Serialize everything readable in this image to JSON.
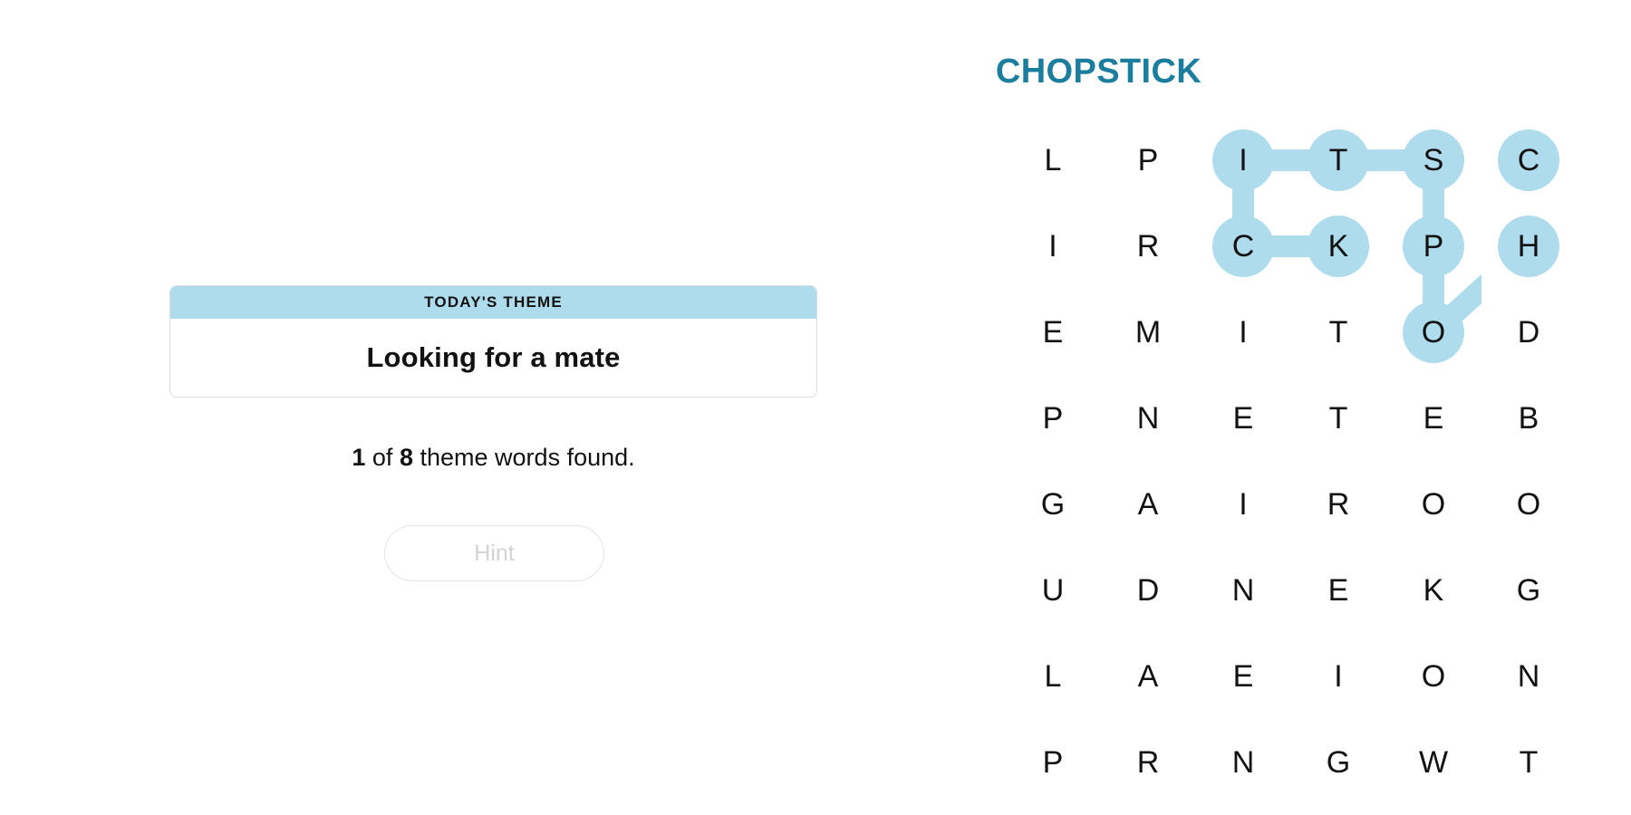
{
  "app": {
    "background_color": "#ffffff",
    "accent_color": "#1b7e9e",
    "highlight_color": "#AEDCEC",
    "text_color": "#121212"
  },
  "puzzle": {
    "title": "CHOPSTICK"
  },
  "theme_card": {
    "header_label": "TODAY'S THEME",
    "clue": "Looking for a mate",
    "header_bg": "#AEDCEC"
  },
  "progress": {
    "found": "1",
    "of_label": "of",
    "total": "8",
    "suffix": "theme words found."
  },
  "hint_button": {
    "label": "Hint",
    "enabled": false
  },
  "grid": {
    "rows": 8,
    "cols": 6,
    "letters": [
      [
        "L",
        "P",
        "I",
        "T",
        "S",
        "C"
      ],
      [
        "I",
        "R",
        "C",
        "K",
        "P",
        "H"
      ],
      [
        "E",
        "M",
        "I",
        "T",
        "O",
        "D"
      ],
      [
        "P",
        "N",
        "E",
        "T",
        "E",
        "B"
      ],
      [
        "G",
        "A",
        "I",
        "R",
        "O",
        "O"
      ],
      [
        "U",
        "D",
        "N",
        "E",
        "K",
        "G"
      ],
      [
        "L",
        "A",
        "E",
        "I",
        "O",
        "N"
      ],
      [
        "P",
        "R",
        "N",
        "G",
        "W",
        "T"
      ]
    ],
    "found_word": "CHOPSTICK",
    "selected_path": [
      {
        "row": 0,
        "col": 5,
        "letter": "C"
      },
      {
        "row": 1,
        "col": 5,
        "letter": "H"
      },
      {
        "row": 2,
        "col": 4,
        "letter": "O"
      },
      {
        "row": 1,
        "col": 4,
        "letter": "P"
      },
      {
        "row": 0,
        "col": 4,
        "letter": "S"
      },
      {
        "row": 0,
        "col": 3,
        "letter": "T"
      },
      {
        "row": 0,
        "col": 2,
        "letter": "I"
      },
      {
        "row": 1,
        "col": 2,
        "letter": "C"
      },
      {
        "row": 1,
        "col": 3,
        "letter": "K"
      }
    ]
  }
}
